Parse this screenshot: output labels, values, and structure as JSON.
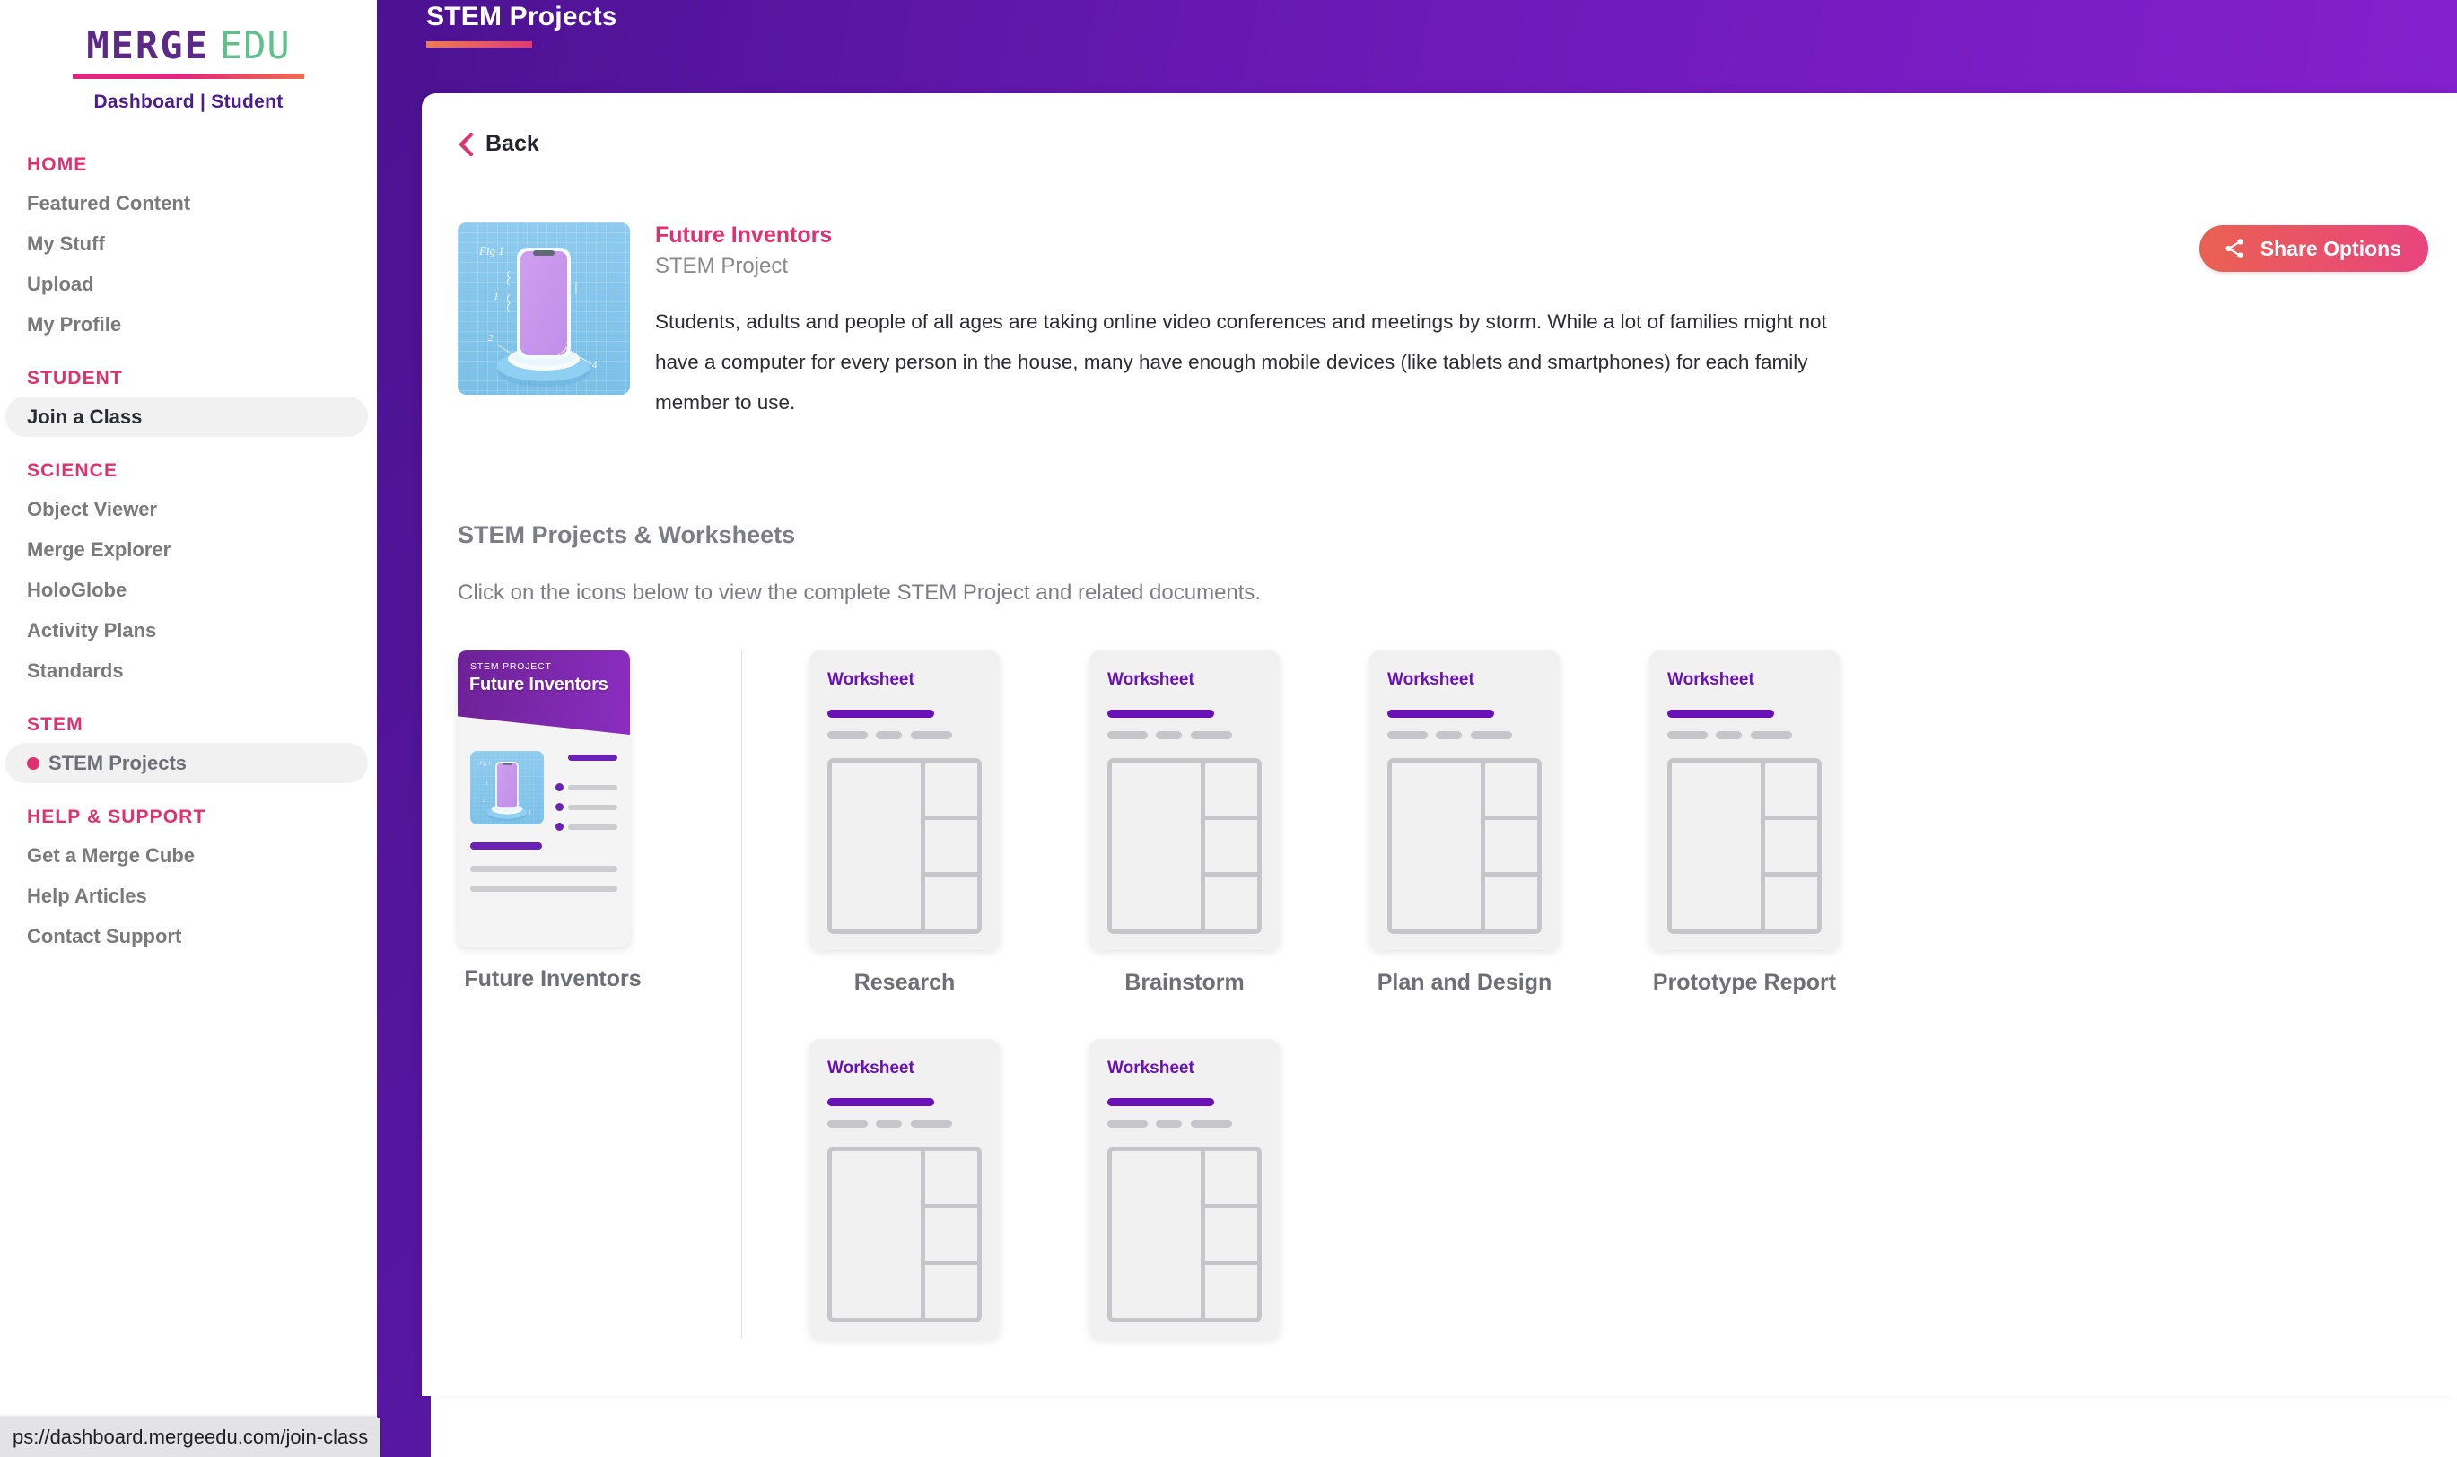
{
  "brand": {
    "logo_primary": "MERGE",
    "logo_secondary": "EDU",
    "logo_subtitle": "Dashboard | Student",
    "accent_pink": "#e0306f",
    "accent_purple": "#6a12b8",
    "header_gradient_start": "#4b1291",
    "header_gradient_end": "#8420ce"
  },
  "sidebar": {
    "groups": [
      {
        "heading": "HOME",
        "items": [
          {
            "label": "Featured Content",
            "state": "normal"
          },
          {
            "label": "My Stuff",
            "state": "normal"
          },
          {
            "label": "Upload",
            "state": "normal"
          },
          {
            "label": "My Profile",
            "state": "normal"
          }
        ]
      },
      {
        "heading": "STUDENT",
        "items": [
          {
            "label": "Join a Class",
            "state": "hover"
          }
        ]
      },
      {
        "heading": "SCIENCE",
        "items": [
          {
            "label": "Object Viewer",
            "state": "normal"
          },
          {
            "label": "Merge Explorer",
            "state": "normal"
          },
          {
            "label": "HoloGlobe",
            "state": "normal"
          },
          {
            "label": "Activity Plans",
            "state": "normal"
          },
          {
            "label": "Standards",
            "state": "normal"
          }
        ]
      },
      {
        "heading": "STEM",
        "items": [
          {
            "label": "STEM Projects",
            "state": "active"
          }
        ]
      },
      {
        "heading": "HELP & SUPPORT",
        "items": [
          {
            "label": "Get a Merge Cube",
            "state": "normal"
          },
          {
            "label": "Help Articles",
            "state": "normal"
          },
          {
            "label": "Contact Support",
            "state": "normal"
          }
        ]
      }
    ]
  },
  "header": {
    "title": "STEM Projects"
  },
  "main": {
    "back_label": "Back",
    "detail": {
      "title": "Future Inventors",
      "subtitle": "STEM Project",
      "description": "Students, adults and people of all ages are taking online video conferences and meetings by storm. While a lot of families might not have a computer for every person in the house, many have enough mobile devices (like tablets and smartphones) for each family member to use."
    },
    "share_button_label": "Share Options",
    "section": {
      "title": "STEM Projects & Worksheets",
      "description": "Click on the icons below to view the complete STEM Project and related documents."
    },
    "project_card": {
      "kicker": "STEM PROJECT",
      "name": "Future Inventors",
      "caption": "Future Inventors"
    },
    "worksheets": [
      {
        "kicker": "Worksheet",
        "caption": "Research"
      },
      {
        "kicker": "Worksheet",
        "caption": "Brainstorm"
      },
      {
        "kicker": "Worksheet",
        "caption": "Plan and Design"
      },
      {
        "kicker": "Worksheet",
        "caption": "Prototype Report"
      },
      {
        "kicker": "Worksheet",
        "caption": ""
      },
      {
        "kicker": "Worksheet",
        "caption": ""
      }
    ]
  },
  "statusbar": {
    "url": "ps://dashboard.mergeedu.com/join-class"
  },
  "thumbnail_art": {
    "figure_label": "Fig 1",
    "callouts": [
      "1",
      "2",
      "3",
      "4"
    ]
  }
}
